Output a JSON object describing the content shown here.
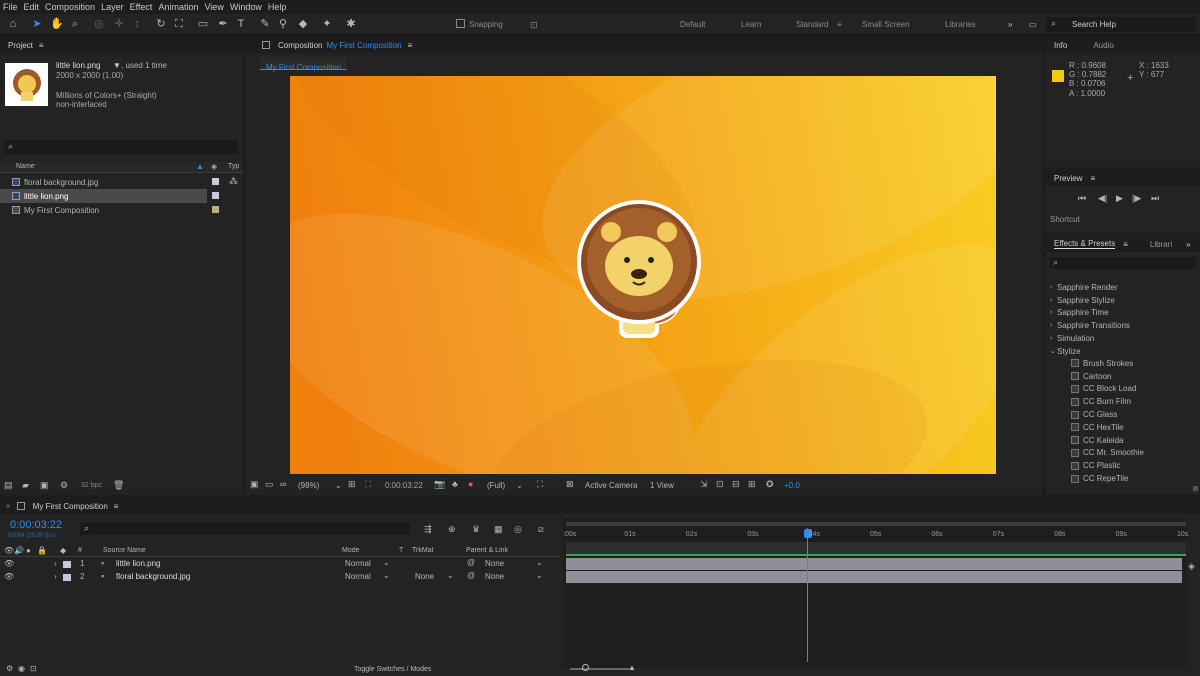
{
  "menu": [
    "File",
    "Edit",
    "Composition",
    "Layer",
    "Effect",
    "Animation",
    "View",
    "Window",
    "Help"
  ],
  "toolbar": {
    "snapping": "Snapping",
    "workspaces": [
      "Default",
      "Learn",
      "Standard",
      "Small Screen",
      "Libraries"
    ],
    "active_workspace": "Standard",
    "search_help": "Search Help"
  },
  "project": {
    "title": "Project",
    "file_name": "little lion.png",
    "used": ", used 1 time",
    "dims": "2000 x 2000 (1.00)",
    "colors": "Millions of Colors+ (Straight)",
    "interlace": "non-interlaced",
    "col_name": "Name",
    "col_type": "Typ",
    "items": [
      "floral background.jpg",
      "little lion.png",
      "My First Composition"
    ],
    "bpc": "32 bpc"
  },
  "composition": {
    "title": "Composition",
    "name": "My First Composition",
    "tab": "My First Composition",
    "zoom": "(98%)",
    "timecode": "0:00:03:22",
    "resolution": "(Full)",
    "camera": "Active Camera",
    "view": "1 View",
    "exposure": "+0.0"
  },
  "info": {
    "tab": "Info",
    "audio_tab": "Audio",
    "r": "R : 0.9608",
    "g": "G : 0.7882",
    "b": "B : 0.0706",
    "a": "A : 1.0000",
    "x": "X : 1633",
    "y": "Y : 677",
    "swatch": "#f2c812"
  },
  "preview": {
    "title": "Preview",
    "shortcut": "Shortcut"
  },
  "effects": {
    "title": "Effects & Presets",
    "libraries": "Librari",
    "categories": [
      "Sapphire Render",
      "Sapphire Stylize",
      "Sapphire Time",
      "Sapphire Transitions",
      "Simulation",
      "Stylize"
    ],
    "stylize_items": [
      "Brush Strokes",
      "Cartoon",
      "CC Block Load",
      "CC Burn Film",
      "CC Glass",
      "CC HexTile",
      "CC Kaleida",
      "CC Mr. Smoothie",
      "CC Plastic",
      "CC RepeTile"
    ]
  },
  "timeline": {
    "tab": "My First Composition",
    "timecode": "0:00:03:22",
    "fps": "00094 (25.00 fps)",
    "cols": {
      "source": "Source Name",
      "mode": "Mode",
      "t": "T",
      "trkmat": "TrkMat",
      "parent": "Parent & Link"
    },
    "layers": [
      {
        "num": "1",
        "name": "little lion.png",
        "mode": "Normal",
        "trkmat": "",
        "parent": "None"
      },
      {
        "num": "2",
        "name": "floral background.jpg",
        "mode": "Normal",
        "trkmat": "None",
        "parent": "None"
      }
    ],
    "ticks": [
      ":00s",
      "01s",
      "02s",
      "03s",
      "04s",
      "05s",
      "06s",
      "07s",
      "08s",
      "09s",
      "10s"
    ],
    "toggle": "Toggle Switches / Modes"
  },
  "colors": {
    "accent": "#2f8cf2",
    "orange": "#f07f0e",
    "yellow": "#f5c21a",
    "track": "#8f8f99",
    "bar_green": "#2fa84f"
  }
}
